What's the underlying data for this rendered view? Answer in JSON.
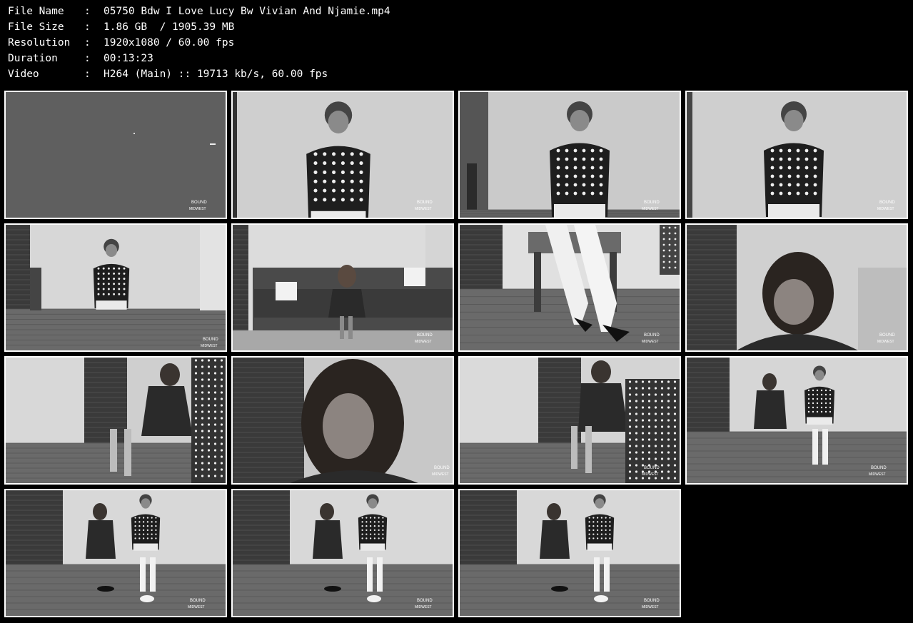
{
  "info": {
    "rows": [
      {
        "key": "File Name",
        "sep": ":",
        "value": "05750 Bdw I Love Lucy Bw Vivian And Njamie.mp4"
      },
      {
        "key": "File Size",
        "sep": ":",
        "value": "1.86 GB  / 1905.39 MB"
      },
      {
        "key": "Resolution",
        "sep": ":",
        "value": "1920x1080 / 60.00 fps"
      },
      {
        "key": "Duration",
        "sep": ":",
        "value": "00:13:23"
      },
      {
        "key": "Video",
        "sep": ":",
        "value": "H264 (Main) :: 19713 kb/s, 60.00 fps"
      }
    ]
  },
  "thumbnails": [
    {
      "kind": "blank"
    },
    {
      "kind": "closeup-dots"
    },
    {
      "kind": "closeup-dots-plant"
    },
    {
      "kind": "closeup-dots-left"
    },
    {
      "kind": "room-seated-dots"
    },
    {
      "kind": "sofa"
    },
    {
      "kind": "legs-heels"
    },
    {
      "kind": "face-hair"
    },
    {
      "kind": "seated-dark-curtain"
    },
    {
      "kind": "face-closeup"
    },
    {
      "kind": "seated-dark-curtain-2"
    },
    {
      "kind": "two-seated"
    },
    {
      "kind": "two-seated-wide"
    },
    {
      "kind": "two-seated-wide"
    },
    {
      "kind": "two-seated-wide"
    }
  ],
  "watermark": {
    "line1": "BOUND",
    "line2": "MIDWEST"
  }
}
